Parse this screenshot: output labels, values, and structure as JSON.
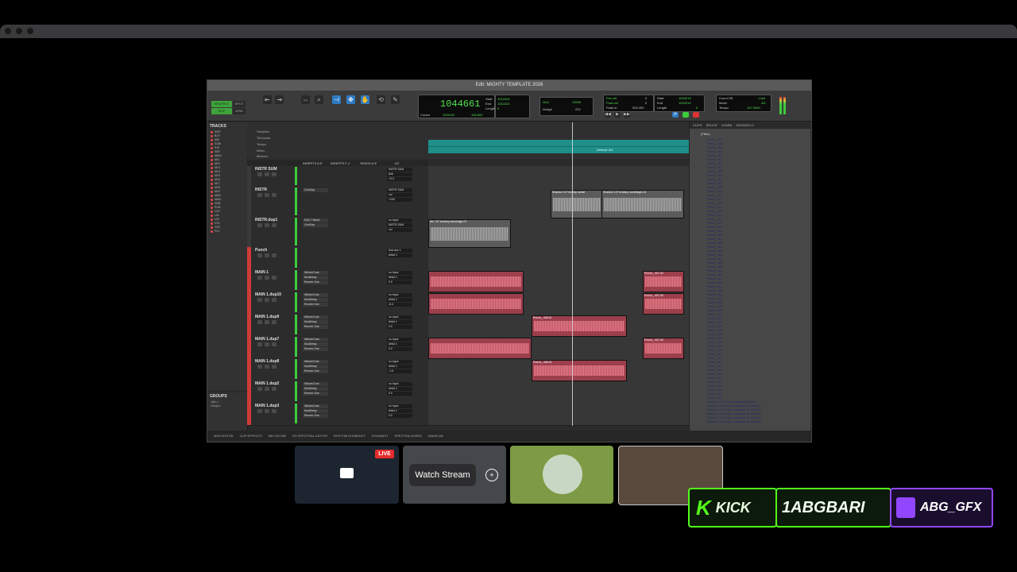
{
  "window": {
    "title": "Edit: MIGHTY TEMPLATE 2026"
  },
  "toolbar": {
    "modes": [
      "SHUFFLE",
      "SPOT",
      "SLIP",
      "GRID"
    ],
    "main_counter": "1044661",
    "counter_rows": [
      {
        "label": "Start",
        "value": "1012224"
      },
      {
        "label": "End",
        "value": "1012224"
      },
      {
        "label": "Length",
        "value": "0"
      }
    ],
    "cursor_label": "Cursor",
    "cursor_value": "1021102",
    "cursor_value2": "106.602",
    "grid_label": "Grid",
    "grid_value": "10000",
    "nudge_label": "Nudge",
    "nudge_value": "222",
    "preroll": [
      {
        "label": "Pre-roll",
        "value": "0"
      },
      {
        "label": "Post-roll",
        "value": "0"
      },
      {
        "label": "Fade-in",
        "value": "000.250"
      }
    ],
    "start_end": [
      {
        "label": "Start",
        "value": "1024219"
      },
      {
        "label": "End",
        "value": "1024219"
      },
      {
        "label": "Length",
        "value": "0"
      }
    ],
    "tempo": [
      {
        "label": "Count Off",
        "value": "1 bar"
      },
      {
        "label": "Meter",
        "value": "4/4"
      },
      {
        "label": "Tempo",
        "value": "147.0000"
      }
    ],
    "colors": {
      "accent_green": "#50e34d",
      "button_blue": "#2f7bc3"
    }
  },
  "tracks_panel": {
    "title": "TRACKS",
    "items": [
      "INST",
      "BGT",
      "MIX",
      "SUM",
      "S10",
      "SMT",
      "MAIN",
      "M11",
      "M12",
      "M13",
      "M14",
      "M15",
      "M16",
      "M17",
      "M18",
      "M19",
      "MAN",
      "MAN",
      "DUB",
      "PUN",
      "CUT",
      "L01",
      "L02",
      "VO1",
      "VO2",
      "FX1"
    ]
  },
  "groups_panel": {
    "title": "GROUPS",
    "items": [
      "<ALL>",
      "Group 1"
    ]
  },
  "rulers": [
    "Samples",
    "Timecode",
    "Tempo",
    "Meter",
    "Markers"
  ],
  "ruler_marker_text": "Default: 4/4",
  "column_headers": [
    "INSERTS A-E",
    "INSERTS F-J",
    "SENDS A-E",
    "I/O"
  ],
  "tracks": [
    {
      "name": "INSTR SUM",
      "inserts": [],
      "io": [
        "INSTR SUM",
        "Mid",
        "+0.0"
      ],
      "color": "#3a3a3a",
      "height": 26
    },
    {
      "name": "INSTR",
      "inserts": [
        "ChnStrp"
      ],
      "io": [
        "INSTR SUM",
        "vol",
        "+100"
      ],
      "color": "#3a3a3a",
      "height": 38
    },
    {
      "name": "INSTR.dup1",
      "inserts": [
        "EQ3 7-Band",
        "ChnStrp"
      ],
      "io": [
        "no input",
        "INSTR SUM",
        "vol"
      ],
      "color": "#3a3a3a",
      "height": 38
    },
    {
      "name": "Punch",
      "inserts": [],
      "io": [
        "Sub dec 1",
        "Artist 1"
      ],
      "color": "#d03a3a",
      "height": 28
    },
    {
      "name": "MAIN 1",
      "inserts": [
        "WAvesTune",
        "ModDelay",
        "Reverb One"
      ],
      "io": [
        "no input",
        "Artist 1",
        "0.0"
      ],
      "color": "#d03a3a",
      "height": 28
    },
    {
      "name": "MAIN 1.dup10",
      "inserts": [
        "WAvesTune",
        "ModDelay",
        "Reverb One"
      ],
      "io": [
        "no input",
        "Artist 1",
        "-8.4"
      ],
      "color": "#d03a3a",
      "height": 28
    },
    {
      "name": "MAIN 1.dup9",
      "inserts": [
        "WAvesTune",
        "ModDelay",
        "Reverb One"
      ],
      "io": [
        "no input",
        "Artist 1",
        "0.0"
      ],
      "color": "#d03a3a",
      "height": 28
    },
    {
      "name": "MAIN 1.dup7",
      "inserts": [
        "WAvesTune",
        "ModDelay",
        "Reverb One"
      ],
      "io": [
        "no input",
        "Artist 1",
        "0.0"
      ],
      "color": "#d03a3a",
      "height": 28
    },
    {
      "name": "MAIN 1.dup8",
      "inserts": [
        "WAvesTune",
        "ModDelay",
        "Reverb One"
      ],
      "io": [
        "no input",
        "Artist 1",
        "-1.5"
      ],
      "color": "#d03a3a",
      "height": 28
    },
    {
      "name": "MAIN 1.dup2",
      "inserts": [
        "WAvesTune",
        "ModDelay",
        "Reverb One"
      ],
      "io": [
        "no input",
        "Artist 1",
        "0.0"
      ],
      "color": "#d03a3a",
      "height": 28
    },
    {
      "name": "MAIN 1.dup3",
      "inserts": [
        "WAvesTune",
        "ModDelay",
        "Reverb One"
      ],
      "io": [
        "no input",
        "Artist 1",
        "0.0"
      ],
      "color": "#d03a3a",
      "height": 28
    }
  ],
  "clips": {
    "shadow_1": "Shadow 147 bruhsy camel",
    "shadow_2": "Shadow 147 brufany camelsigh-16",
    "live": "live 147 brufany camelsigh-07",
    "punch_a": "Punch_.407-03",
    "punch_b": "Punch_.407-05",
    "punch_c": "Punch_.498-01",
    "punch_d": "Punch_.407-03",
    "punch_e": "Punch_.498-01"
  },
  "clips_panel": {
    "tabs": [
      "CLIPS",
      "SPLICE",
      "LEARN",
      "SOUNDFLO"
    ],
    "filter": "(Filter)",
    "items": [
      "Punch_.457",
      "Punch_.458",
      "Punch_.459",
      "Punch_.460",
      "Punch_.461",
      "Punch_.462",
      "Punch_.463",
      "Punch_.464",
      "Punch_.465",
      "Punch_.466",
      "Punch_.467",
      "Punch_.468",
      "Punch_.469",
      "Punch_.470",
      "Punch_.471",
      "Punch_.472",
      "Punch_.473",
      "Punch_.474",
      "Punch_.475",
      "Punch_.476",
      "Punch_.477",
      "Punch_.478",
      "Punch_.479",
      "Punch_.480",
      "Punch_.481",
      "Punch_.482",
      "Punch_.483",
      "Punch_.484",
      "Punch_.485",
      "Punch_.486",
      "Punch_.487",
      "Punch_.488",
      "Punch_.489",
      "Punch_.490",
      "Punch_.491",
      "Punch_.492",
      "Punch_.493",
      "Punch_.494",
      "Punch_.495",
      "Punch_.496",
      "Punch_.497",
      "Punch_.498",
      "Punch_.499",
      "Punch_.500",
      "Punch_.501",
      "Punch_.502",
      "Punch_.503",
      "Punch_.504",
      "Punch_.505",
      "Punch_.506",
      "Punch_.507",
      "Punch_.508",
      "Punch_.509",
      "Punch_.510",
      "Punch_.511",
      "Punch_.512",
      "Punch_.513",
      "Punch_.514",
      "Punch_.515",
      "Punch_.516",
      "Punch_.517",
      "Punch_.518",
      "Punch_.519",
      "Punch_.520",
      "Punch_.521",
      "Punch_.522",
      "Shadow 147 brufany camelsigh (Stereo)",
      "Shadow 147 brufany camelsigh-01 (Stereo)",
      "Shadow 147 brufany camelsigh-02 (Stereo)",
      "Shadow 147 brufany camelsigh-03 (Stereo)",
      "Shadow 147 brufany camelsigh-04 (Stereo)",
      "Shadow 147 brufany camelsigh-05 (Stereo)"
    ]
  },
  "bottom_tabs": [
    "MIDI EDITOR",
    "CLIP EFFECTS",
    "MELODYNE",
    "RX SPECTRAL EDITOR",
    "RHYTHM ELEMENTS",
    "DYNAMIXT",
    "SPECTRALAYERS",
    "WAVELAB"
  ],
  "stream": {
    "live_label": "LIVE",
    "watch_label": "Watch Stream"
  },
  "badges": {
    "kick": "KICK",
    "kick_handle": "1ABGBARI",
    "twitch_handle": "ABG_GFX",
    "kick_color": "#53fc18",
    "twitch_color": "#9146ff"
  }
}
